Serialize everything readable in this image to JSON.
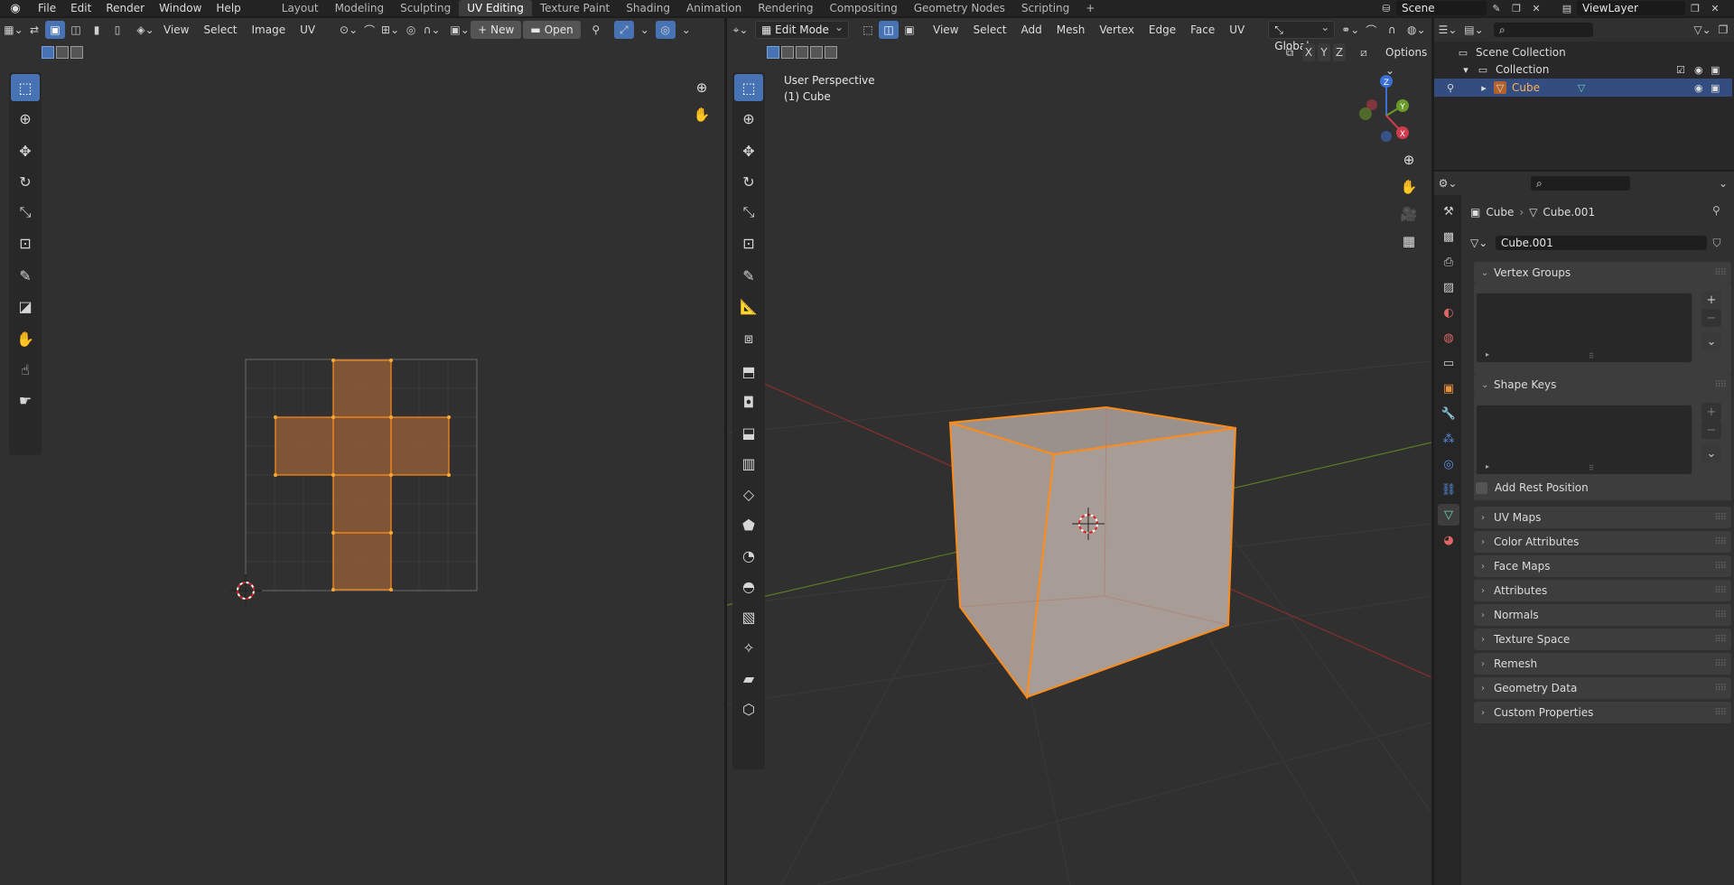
{
  "topbar": {
    "menus": [
      "File",
      "Edit",
      "Render",
      "Window",
      "Help"
    ],
    "workspaces": [
      "Layout",
      "Modeling",
      "Sculpting",
      "UV Editing",
      "Texture Paint",
      "Shading",
      "Animation",
      "Rendering",
      "Compositing",
      "Geometry Nodes",
      "Scripting"
    ],
    "active_workspace": "UV Editing",
    "add_tab": "+",
    "scene_name": "Scene",
    "view_layer": "ViewLayer"
  },
  "uv_editor": {
    "menus": [
      "View",
      "Select",
      "Image",
      "UV"
    ],
    "new_label": "New",
    "open_label": "Open"
  },
  "viewport": {
    "mode": "Edit Mode",
    "menus": [
      "View",
      "Select",
      "Add",
      "Mesh",
      "Vertex",
      "Edge",
      "Face",
      "UV"
    ],
    "transform_orientation": "Global",
    "axis_x": "X",
    "axis_y": "Y",
    "axis_z": "Z",
    "options_label": "Options",
    "overlay_line1": "User Perspective",
    "overlay_line2": "(1) Cube",
    "gizmo_labels": {
      "x": "X",
      "y": "Y",
      "z": "Z"
    }
  },
  "outliner": {
    "scene_collection": "Scene Collection",
    "collection": "Collection",
    "object": "Cube"
  },
  "properties": {
    "breadcrumb_object": "Cube",
    "breadcrumb_data": "Cube.001",
    "datablock_name": "Cube.001",
    "panels": {
      "vertex_groups": "Vertex Groups",
      "shape_keys": "Shape Keys",
      "add_rest_position": "Add Rest Position",
      "uv_maps": "UV Maps",
      "color_attributes": "Color Attributes",
      "face_maps": "Face Maps",
      "attributes": "Attributes",
      "normals": "Normals",
      "texture_space": "Texture Space",
      "remesh": "Remesh",
      "geometry_data": "Geometry Data",
      "custom_properties": "Custom Properties"
    }
  },
  "colors": {
    "accent": "#4772b3",
    "selection_orange": "#ff8c1a",
    "uv_face_fill": "#8a5a36"
  }
}
